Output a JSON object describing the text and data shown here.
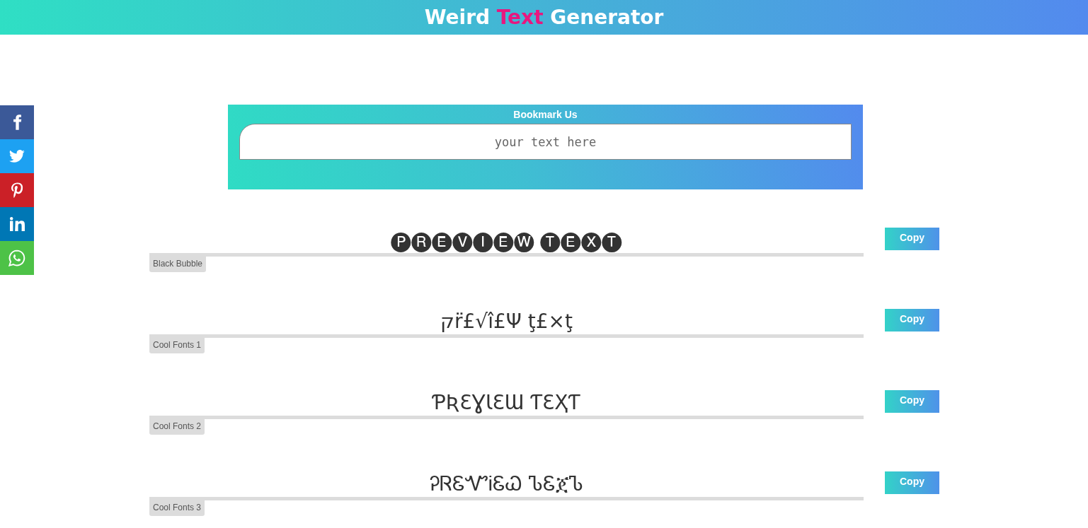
{
  "header": {
    "title": [
      {
        "text": "Weird",
        "highlight": false
      },
      {
        "text": "Text",
        "highlight": true
      },
      {
        "text": "Generator",
        "highlight": false
      }
    ]
  },
  "share_buttons": [
    {
      "kind": "facebook"
    },
    {
      "kind": "twitter"
    },
    {
      "kind": "pinterest"
    },
    {
      "kind": "linkedin"
    },
    {
      "kind": "whatsapp"
    }
  ],
  "bookmark_panel": {
    "title": "Bookmark Us",
    "input": {
      "placeholder": "your text here"
    }
  },
  "styles": [
    {
      "preview": "🅟🅡🅔🅥🅘🅔🅦 🅣🅔🅧🅣",
      "label": "Black Bubble",
      "button": "Copy"
    },
    {
      "preview": "קr̈£√î£Ψ ţ£×ţ",
      "label": "Cool Fonts 1",
      "button": "Copy"
    },
    {
      "preview": "ƤƦƐƔƖƐƜ ƬƐҲƬ",
      "label": "Cool Fonts 2",
      "button": "Copy"
    },
    {
      "preview": "ᎮᏒᏋᏉᎥᏋᏇ ᏖᏋጀᏖ",
      "label": "Cool Fonts 3",
      "button": "Copy"
    }
  ]
}
